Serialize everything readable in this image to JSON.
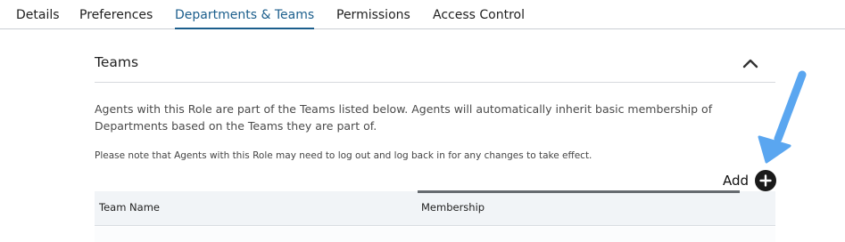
{
  "tabs": [
    {
      "label": "Details",
      "active": false
    },
    {
      "label": "Preferences",
      "active": false
    },
    {
      "label": "Departments & Teams",
      "active": true
    },
    {
      "label": "Permissions",
      "active": false
    },
    {
      "label": "Access Control",
      "active": false
    }
  ],
  "section": {
    "title": "Teams",
    "collapse_icon": "chevron-up-icon",
    "description": "Agents with this Role are part of the Teams listed below. Agents will automatically inherit basic membership of Departments based on the Teams they are part of.",
    "note": "Please note that Agents with this Role may need to log out and log back in for any changes to take effect.",
    "add_label": "Add",
    "add_icon": "plus-circle-icon"
  },
  "table": {
    "columns": [
      "Team Name",
      "Membership"
    ],
    "rows": []
  },
  "colors": {
    "accent": "#1b5e8c",
    "annotation_arrow": "#5aa6f0",
    "table_header_bg": "#f1f4f7",
    "add_button": "#1a1a1a"
  }
}
